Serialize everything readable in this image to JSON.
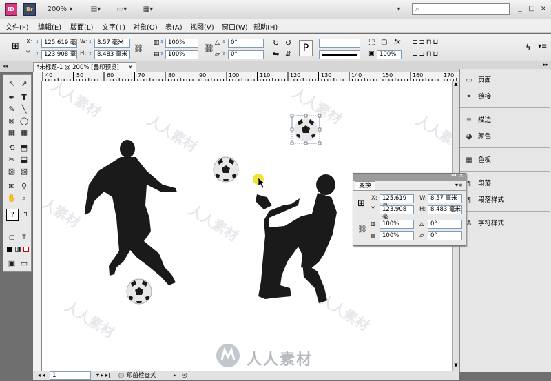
{
  "app": {
    "icon_label": "ID",
    "bridge_label": "Br",
    "zoom": "200%"
  },
  "search": {
    "placeholder": ""
  },
  "window_controls": {
    "minimize": "_",
    "maximize": "□",
    "close": "×"
  },
  "menu": [
    "文件(F)",
    "编辑(E)",
    "版面(L)",
    "文字(T)",
    "对象(O)",
    "表(A)",
    "视图(V)",
    "窗口(W)",
    "帮助(H)"
  ],
  "control": {
    "x_label": "X:",
    "x_value": "125.619 毫",
    "y_label": "Y:",
    "y_value": "123.908 毫",
    "w_label": "W:",
    "w_value": "8.57 毫米",
    "h_label": "H:",
    "h_value": "8.483 毫米",
    "scale_x": "100%",
    "scale_y": "100%",
    "rotate": "0°",
    "shear": "0°",
    "opacity": "100%",
    "stroke_weight": ""
  },
  "document": {
    "tab_title": "*未标题-1 @ 200% [叠印预览]",
    "close": "×"
  },
  "ruler": {
    "h": [
      "40",
      "50",
      "60",
      "70",
      "80",
      "90",
      "100",
      "110",
      "120",
      "130",
      "140",
      "150",
      "160",
      "170"
    ]
  },
  "status": {
    "page": "1",
    "preflight": "印前检查关"
  },
  "panels": [
    {
      "icon": "page-icon",
      "label": "页面"
    },
    {
      "icon": "link-icon",
      "label": "链接"
    },
    {
      "icon": "stroke-icon",
      "label": "描边"
    },
    {
      "icon": "color-icon",
      "label": "颜色"
    },
    {
      "icon": "swatch-icon",
      "label": "色板"
    },
    {
      "icon": "paragraph-icon",
      "label": "段落"
    },
    {
      "icon": "paragraph-style-icon",
      "label": "段落样式"
    },
    {
      "icon": "char-style-icon",
      "label": "字符样式"
    }
  ],
  "transform_panel": {
    "tab": "变换",
    "x_label": "X:",
    "x_value": "125.619 毫",
    "y_label": "Y:",
    "y_value": "123.908 毫",
    "w_label": "W:",
    "w_value": "8.57 毫米",
    "h_label": "H:",
    "h_value": "8.483 毫米",
    "scale_x": "100%",
    "scale_y": "100%",
    "rotate": "0°",
    "shear": "0°"
  },
  "watermark": "人人素材",
  "colors": {
    "accent": "#d23b82",
    "highlight": "#f0e020",
    "silhouette": "#1a1a1a"
  }
}
